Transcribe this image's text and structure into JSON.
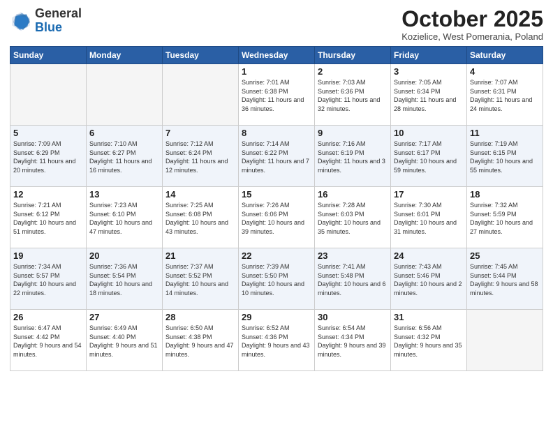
{
  "header": {
    "logo_general": "General",
    "logo_blue": "Blue",
    "month_title": "October 2025",
    "location": "Kozielice, West Pomerania, Poland"
  },
  "days_of_week": [
    "Sunday",
    "Monday",
    "Tuesday",
    "Wednesday",
    "Thursday",
    "Friday",
    "Saturday"
  ],
  "weeks": [
    [
      {
        "day": "",
        "info": ""
      },
      {
        "day": "",
        "info": ""
      },
      {
        "day": "",
        "info": ""
      },
      {
        "day": "1",
        "info": "Sunrise: 7:01 AM\nSunset: 6:38 PM\nDaylight: 11 hours\nand 36 minutes."
      },
      {
        "day": "2",
        "info": "Sunrise: 7:03 AM\nSunset: 6:36 PM\nDaylight: 11 hours\nand 32 minutes."
      },
      {
        "day": "3",
        "info": "Sunrise: 7:05 AM\nSunset: 6:34 PM\nDaylight: 11 hours\nand 28 minutes."
      },
      {
        "day": "4",
        "info": "Sunrise: 7:07 AM\nSunset: 6:31 PM\nDaylight: 11 hours\nand 24 minutes."
      }
    ],
    [
      {
        "day": "5",
        "info": "Sunrise: 7:09 AM\nSunset: 6:29 PM\nDaylight: 11 hours\nand 20 minutes."
      },
      {
        "day": "6",
        "info": "Sunrise: 7:10 AM\nSunset: 6:27 PM\nDaylight: 11 hours\nand 16 minutes."
      },
      {
        "day": "7",
        "info": "Sunrise: 7:12 AM\nSunset: 6:24 PM\nDaylight: 11 hours\nand 12 minutes."
      },
      {
        "day": "8",
        "info": "Sunrise: 7:14 AM\nSunset: 6:22 PM\nDaylight: 11 hours\nand 7 minutes."
      },
      {
        "day": "9",
        "info": "Sunrise: 7:16 AM\nSunset: 6:19 PM\nDaylight: 11 hours\nand 3 minutes."
      },
      {
        "day": "10",
        "info": "Sunrise: 7:17 AM\nSunset: 6:17 PM\nDaylight: 10 hours\nand 59 minutes."
      },
      {
        "day": "11",
        "info": "Sunrise: 7:19 AM\nSunset: 6:15 PM\nDaylight: 10 hours\nand 55 minutes."
      }
    ],
    [
      {
        "day": "12",
        "info": "Sunrise: 7:21 AM\nSunset: 6:12 PM\nDaylight: 10 hours\nand 51 minutes."
      },
      {
        "day": "13",
        "info": "Sunrise: 7:23 AM\nSunset: 6:10 PM\nDaylight: 10 hours\nand 47 minutes."
      },
      {
        "day": "14",
        "info": "Sunrise: 7:25 AM\nSunset: 6:08 PM\nDaylight: 10 hours\nand 43 minutes."
      },
      {
        "day": "15",
        "info": "Sunrise: 7:26 AM\nSunset: 6:06 PM\nDaylight: 10 hours\nand 39 minutes."
      },
      {
        "day": "16",
        "info": "Sunrise: 7:28 AM\nSunset: 6:03 PM\nDaylight: 10 hours\nand 35 minutes."
      },
      {
        "day": "17",
        "info": "Sunrise: 7:30 AM\nSunset: 6:01 PM\nDaylight: 10 hours\nand 31 minutes."
      },
      {
        "day": "18",
        "info": "Sunrise: 7:32 AM\nSunset: 5:59 PM\nDaylight: 10 hours\nand 27 minutes."
      }
    ],
    [
      {
        "day": "19",
        "info": "Sunrise: 7:34 AM\nSunset: 5:57 PM\nDaylight: 10 hours\nand 22 minutes."
      },
      {
        "day": "20",
        "info": "Sunrise: 7:36 AM\nSunset: 5:54 PM\nDaylight: 10 hours\nand 18 minutes."
      },
      {
        "day": "21",
        "info": "Sunrise: 7:37 AM\nSunset: 5:52 PM\nDaylight: 10 hours\nand 14 minutes."
      },
      {
        "day": "22",
        "info": "Sunrise: 7:39 AM\nSunset: 5:50 PM\nDaylight: 10 hours\nand 10 minutes."
      },
      {
        "day": "23",
        "info": "Sunrise: 7:41 AM\nSunset: 5:48 PM\nDaylight: 10 hours\nand 6 minutes."
      },
      {
        "day": "24",
        "info": "Sunrise: 7:43 AM\nSunset: 5:46 PM\nDaylight: 10 hours\nand 2 minutes."
      },
      {
        "day": "25",
        "info": "Sunrise: 7:45 AM\nSunset: 5:44 PM\nDaylight: 9 hours\nand 58 minutes."
      }
    ],
    [
      {
        "day": "26",
        "info": "Sunrise: 6:47 AM\nSunset: 4:42 PM\nDaylight: 9 hours\nand 54 minutes."
      },
      {
        "day": "27",
        "info": "Sunrise: 6:49 AM\nSunset: 4:40 PM\nDaylight: 9 hours\nand 51 minutes."
      },
      {
        "day": "28",
        "info": "Sunrise: 6:50 AM\nSunset: 4:38 PM\nDaylight: 9 hours\nand 47 minutes."
      },
      {
        "day": "29",
        "info": "Sunrise: 6:52 AM\nSunset: 4:36 PM\nDaylight: 9 hours\nand 43 minutes."
      },
      {
        "day": "30",
        "info": "Sunrise: 6:54 AM\nSunset: 4:34 PM\nDaylight: 9 hours\nand 39 minutes."
      },
      {
        "day": "31",
        "info": "Sunrise: 6:56 AM\nSunset: 4:32 PM\nDaylight: 9 hours\nand 35 minutes."
      },
      {
        "day": "",
        "info": ""
      }
    ]
  ]
}
